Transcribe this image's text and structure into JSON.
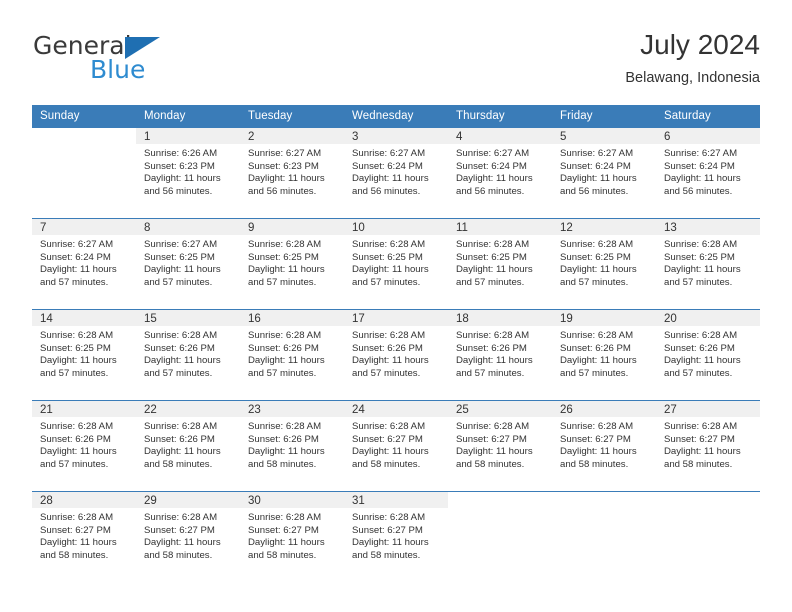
{
  "brand": {
    "name_top": "General",
    "name_bottom": "Blue",
    "triangle_color": "#1f6fb2",
    "blue_color": "#2e8bd0"
  },
  "header": {
    "title": "July 2024",
    "subtitle": "Belawang, Indonesia"
  },
  "theme": {
    "header_bg": "#3a7cb8",
    "header_text": "#ffffff",
    "daynum_band_bg": "#f0f0f0",
    "row_divider": "#3a7cb8"
  },
  "weekday_headers": [
    "Sunday",
    "Monday",
    "Tuesday",
    "Wednesday",
    "Thursday",
    "Friday",
    "Saturday"
  ],
  "weeks": [
    [
      {
        "day": "",
        "lines": []
      },
      {
        "day": "1",
        "lines": [
          "Sunrise: 6:26 AM",
          "Sunset: 6:23 PM",
          "Daylight: 11 hours",
          "and 56 minutes."
        ]
      },
      {
        "day": "2",
        "lines": [
          "Sunrise: 6:27 AM",
          "Sunset: 6:23 PM",
          "Daylight: 11 hours",
          "and 56 minutes."
        ]
      },
      {
        "day": "3",
        "lines": [
          "Sunrise: 6:27 AM",
          "Sunset: 6:24 PM",
          "Daylight: 11 hours",
          "and 56 minutes."
        ]
      },
      {
        "day": "4",
        "lines": [
          "Sunrise: 6:27 AM",
          "Sunset: 6:24 PM",
          "Daylight: 11 hours",
          "and 56 minutes."
        ]
      },
      {
        "day": "5",
        "lines": [
          "Sunrise: 6:27 AM",
          "Sunset: 6:24 PM",
          "Daylight: 11 hours",
          "and 56 minutes."
        ]
      },
      {
        "day": "6",
        "lines": [
          "Sunrise: 6:27 AM",
          "Sunset: 6:24 PM",
          "Daylight: 11 hours",
          "and 56 minutes."
        ]
      }
    ],
    [
      {
        "day": "7",
        "lines": [
          "Sunrise: 6:27 AM",
          "Sunset: 6:24 PM",
          "Daylight: 11 hours",
          "and 57 minutes."
        ]
      },
      {
        "day": "8",
        "lines": [
          "Sunrise: 6:27 AM",
          "Sunset: 6:25 PM",
          "Daylight: 11 hours",
          "and 57 minutes."
        ]
      },
      {
        "day": "9",
        "lines": [
          "Sunrise: 6:28 AM",
          "Sunset: 6:25 PM",
          "Daylight: 11 hours",
          "and 57 minutes."
        ]
      },
      {
        "day": "10",
        "lines": [
          "Sunrise: 6:28 AM",
          "Sunset: 6:25 PM",
          "Daylight: 11 hours",
          "and 57 minutes."
        ]
      },
      {
        "day": "11",
        "lines": [
          "Sunrise: 6:28 AM",
          "Sunset: 6:25 PM",
          "Daylight: 11 hours",
          "and 57 minutes."
        ]
      },
      {
        "day": "12",
        "lines": [
          "Sunrise: 6:28 AM",
          "Sunset: 6:25 PM",
          "Daylight: 11 hours",
          "and 57 minutes."
        ]
      },
      {
        "day": "13",
        "lines": [
          "Sunrise: 6:28 AM",
          "Sunset: 6:25 PM",
          "Daylight: 11 hours",
          "and 57 minutes."
        ]
      }
    ],
    [
      {
        "day": "14",
        "lines": [
          "Sunrise: 6:28 AM",
          "Sunset: 6:25 PM",
          "Daylight: 11 hours",
          "and 57 minutes."
        ]
      },
      {
        "day": "15",
        "lines": [
          "Sunrise: 6:28 AM",
          "Sunset: 6:26 PM",
          "Daylight: 11 hours",
          "and 57 minutes."
        ]
      },
      {
        "day": "16",
        "lines": [
          "Sunrise: 6:28 AM",
          "Sunset: 6:26 PM",
          "Daylight: 11 hours",
          "and 57 minutes."
        ]
      },
      {
        "day": "17",
        "lines": [
          "Sunrise: 6:28 AM",
          "Sunset: 6:26 PM",
          "Daylight: 11 hours",
          "and 57 minutes."
        ]
      },
      {
        "day": "18",
        "lines": [
          "Sunrise: 6:28 AM",
          "Sunset: 6:26 PM",
          "Daylight: 11 hours",
          "and 57 minutes."
        ]
      },
      {
        "day": "19",
        "lines": [
          "Sunrise: 6:28 AM",
          "Sunset: 6:26 PM",
          "Daylight: 11 hours",
          "and 57 minutes."
        ]
      },
      {
        "day": "20",
        "lines": [
          "Sunrise: 6:28 AM",
          "Sunset: 6:26 PM",
          "Daylight: 11 hours",
          "and 57 minutes."
        ]
      }
    ],
    [
      {
        "day": "21",
        "lines": [
          "Sunrise: 6:28 AM",
          "Sunset: 6:26 PM",
          "Daylight: 11 hours",
          "and 57 minutes."
        ]
      },
      {
        "day": "22",
        "lines": [
          "Sunrise: 6:28 AM",
          "Sunset: 6:26 PM",
          "Daylight: 11 hours",
          "and 58 minutes."
        ]
      },
      {
        "day": "23",
        "lines": [
          "Sunrise: 6:28 AM",
          "Sunset: 6:26 PM",
          "Daylight: 11 hours",
          "and 58 minutes."
        ]
      },
      {
        "day": "24",
        "lines": [
          "Sunrise: 6:28 AM",
          "Sunset: 6:27 PM",
          "Daylight: 11 hours",
          "and 58 minutes."
        ]
      },
      {
        "day": "25",
        "lines": [
          "Sunrise: 6:28 AM",
          "Sunset: 6:27 PM",
          "Daylight: 11 hours",
          "and 58 minutes."
        ]
      },
      {
        "day": "26",
        "lines": [
          "Sunrise: 6:28 AM",
          "Sunset: 6:27 PM",
          "Daylight: 11 hours",
          "and 58 minutes."
        ]
      },
      {
        "day": "27",
        "lines": [
          "Sunrise: 6:28 AM",
          "Sunset: 6:27 PM",
          "Daylight: 11 hours",
          "and 58 minutes."
        ]
      }
    ],
    [
      {
        "day": "28",
        "lines": [
          "Sunrise: 6:28 AM",
          "Sunset: 6:27 PM",
          "Daylight: 11 hours",
          "and 58 minutes."
        ]
      },
      {
        "day": "29",
        "lines": [
          "Sunrise: 6:28 AM",
          "Sunset: 6:27 PM",
          "Daylight: 11 hours",
          "and 58 minutes."
        ]
      },
      {
        "day": "30",
        "lines": [
          "Sunrise: 6:28 AM",
          "Sunset: 6:27 PM",
          "Daylight: 11 hours",
          "and 58 minutes."
        ]
      },
      {
        "day": "31",
        "lines": [
          "Sunrise: 6:28 AM",
          "Sunset: 6:27 PM",
          "Daylight: 11 hours",
          "and 58 minutes."
        ]
      },
      {
        "day": "",
        "lines": []
      },
      {
        "day": "",
        "lines": []
      },
      {
        "day": "",
        "lines": []
      }
    ]
  ]
}
